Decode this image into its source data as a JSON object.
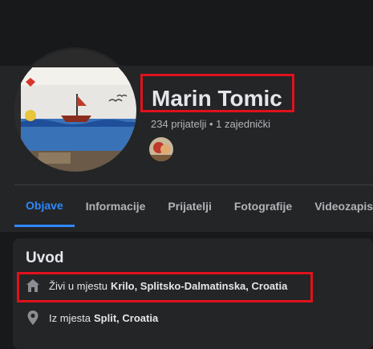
{
  "profile": {
    "name": "Marin Tomic",
    "friends_summary": "234 prijatelji • 1 zajednički"
  },
  "tabs": [
    {
      "label": "Objave"
    },
    {
      "label": "Informacije"
    },
    {
      "label": "Prijatelji"
    },
    {
      "label": "Fotografije"
    },
    {
      "label": "Videozapisi"
    }
  ],
  "intro": {
    "title": "Uvod",
    "lives_prefix": "Živi u mjestu",
    "lives_value": "Krilo, Splitsko-Dalmatinska, Croatia",
    "from_prefix": "Iz mjesta",
    "from_value": "Split, Croatia"
  },
  "colors": {
    "accent": "#2d88ff",
    "highlight": "#e0121c",
    "background": "#18191a",
    "card": "#242526"
  },
  "icons": {
    "home": "home-icon",
    "location": "location-pin-icon"
  }
}
